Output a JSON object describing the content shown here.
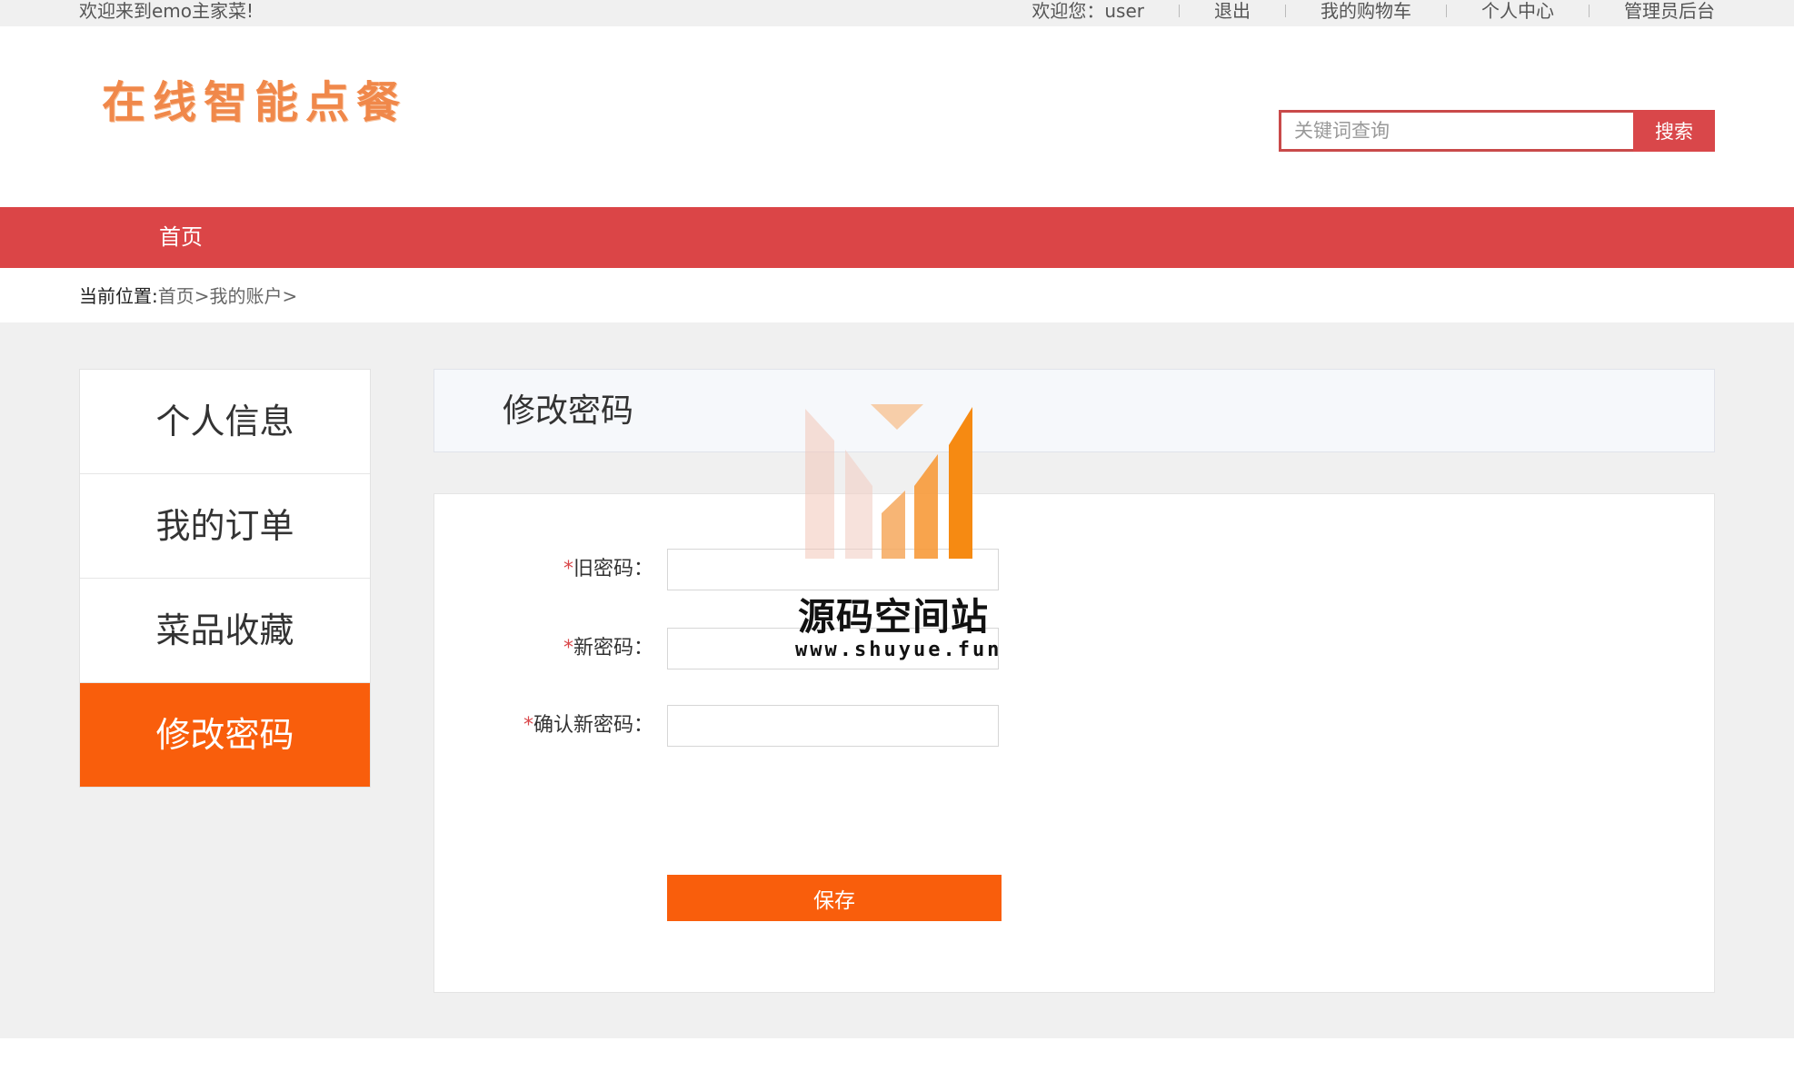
{
  "topbar": {
    "welcome": "欢迎来到emo主家菜!",
    "greeting": "欢迎您：user",
    "logout": "退出",
    "cart": "我的购物车",
    "profile": "个人中心",
    "admin": "管理员后台"
  },
  "header": {
    "logo": "在线智能点餐",
    "search_placeholder": "关键词查询",
    "search_button": "搜索"
  },
  "nav": {
    "home": "首页"
  },
  "breadcrumb": {
    "label": "当前位置:",
    "home": "首页",
    "sep1": ">",
    "account": "我的账户",
    "sep2": ">"
  },
  "sidebar": {
    "items": [
      {
        "label": "个人信息"
      },
      {
        "label": "我的订单"
      },
      {
        "label": "菜品收藏"
      },
      {
        "label": "修改密码",
        "active": true
      }
    ]
  },
  "panel": {
    "title": "修改密码",
    "required_mark": "*",
    "old_password_label": "旧密码：",
    "new_password_label": "新密码：",
    "confirm_password_label": "确认新密码：",
    "save_button": "保存"
  },
  "watermark": {
    "name": "源码空间站",
    "url": "www.shuyue.fun"
  },
  "colors": {
    "nav_red": "#db4547",
    "accent_orange": "#f95e0c",
    "logo_orange": "#f0884a"
  }
}
